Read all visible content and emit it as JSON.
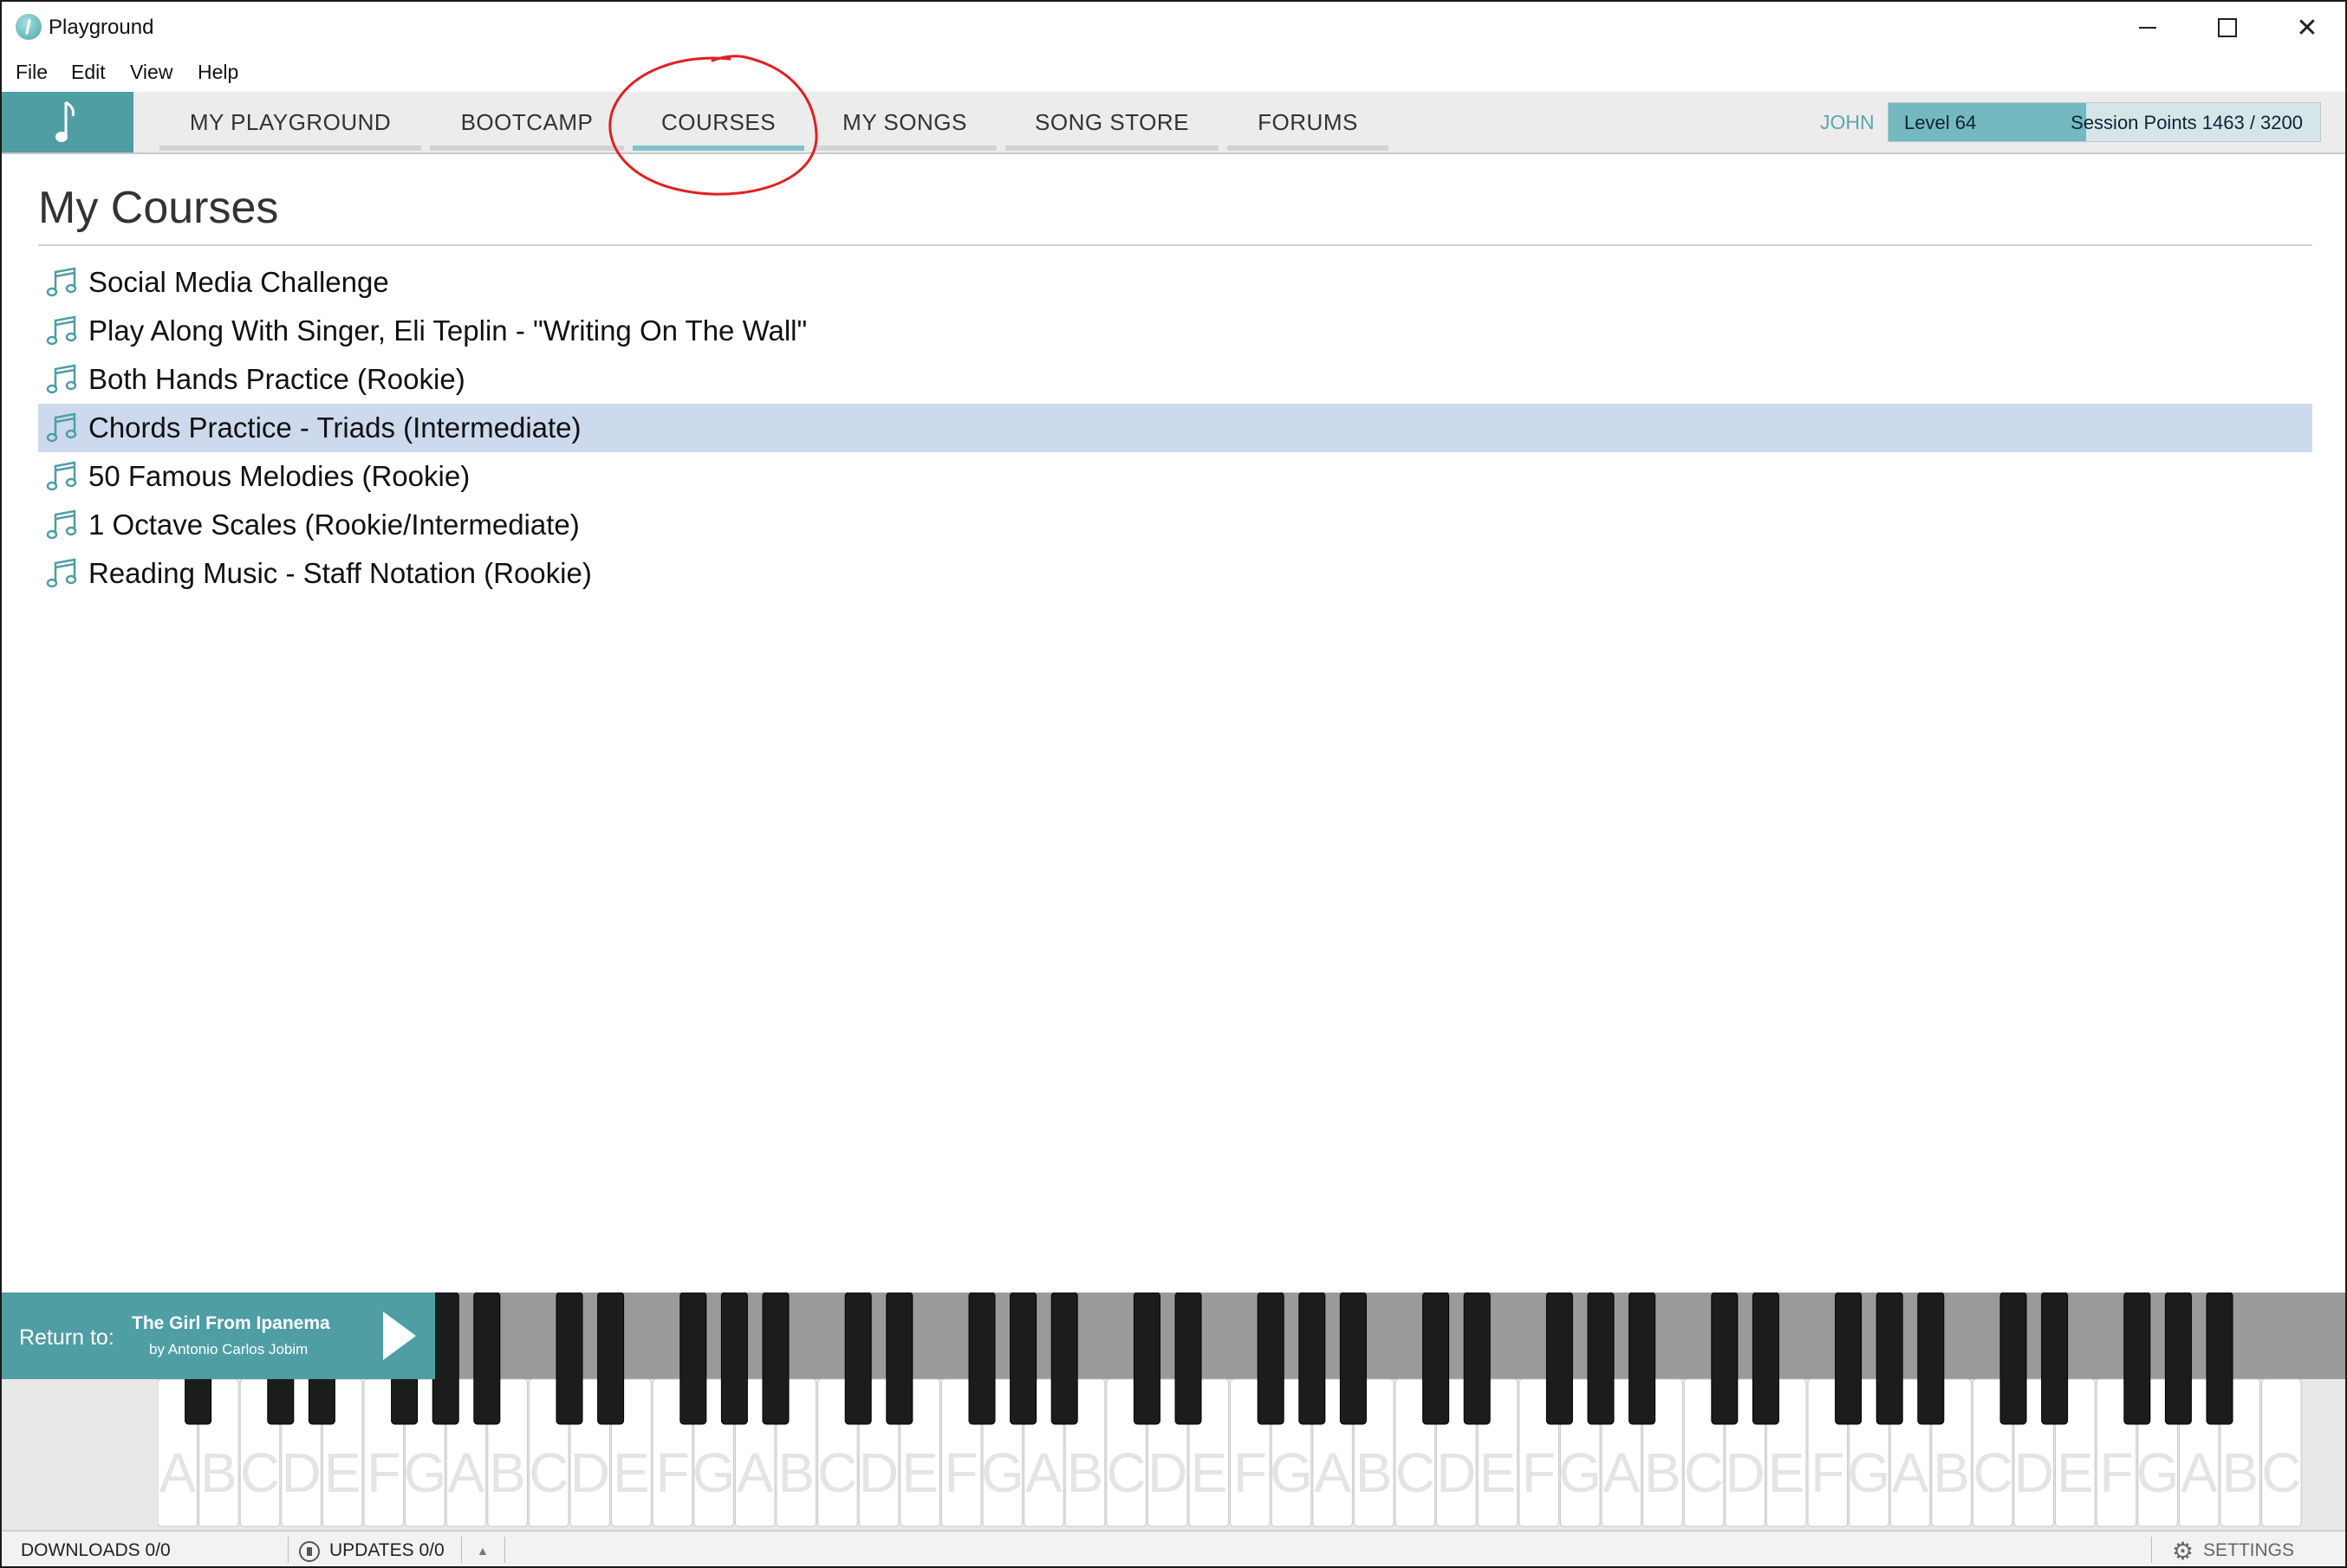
{
  "window": {
    "title": "Playground",
    "controls": {
      "minimize": "",
      "maximize": "",
      "close": "✕"
    }
  },
  "menu": [
    "File",
    "Edit",
    "View",
    "Help"
  ],
  "nav": {
    "tabs": [
      {
        "label": "MY PLAYGROUND",
        "active": false
      },
      {
        "label": "BOOTCAMP",
        "active": false
      },
      {
        "label": "COURSES",
        "active": true
      },
      {
        "label": "MY SONGS",
        "active": false
      },
      {
        "label": "SONG STORE",
        "active": false
      },
      {
        "label": "FORUMS",
        "active": false
      }
    ],
    "user": "JOHN",
    "level": "Level 64",
    "session_points_text": "Session Points 1463 / 3200",
    "session_points_current": 1463,
    "session_points_max": 3200
  },
  "page": {
    "heading": "My Courses",
    "courses": [
      {
        "label": "Social Media Challenge",
        "selected": false
      },
      {
        "label": "Play Along With Singer, Eli Teplin - \"Writing On The Wall\"",
        "selected": false
      },
      {
        "label": "Both Hands Practice (Rookie)",
        "selected": false
      },
      {
        "label": "Chords Practice - Triads (Intermediate)",
        "selected": true
      },
      {
        "label": "50 Famous Melodies (Rookie)",
        "selected": false
      },
      {
        "label": "1 Octave Scales (Rookie/Intermediate)",
        "selected": false
      },
      {
        "label": "Reading Music - Staff Notation (Rookie)",
        "selected": false
      }
    ]
  },
  "player": {
    "return_label": "Return to:",
    "song_title": "The Girl From Ipanema",
    "song_artist": "by Antonio Carlos Jobim"
  },
  "piano": {
    "white_key_letters": [
      "A",
      "B",
      "C",
      "D",
      "E",
      "F",
      "G",
      "A",
      "B",
      "C",
      "D",
      "E",
      "F",
      "G",
      "A",
      "B",
      "C",
      "D",
      "E",
      "F",
      "G",
      "A",
      "B",
      "C",
      "D",
      "E",
      "F",
      "G",
      "A",
      "B",
      "C",
      "D",
      "E",
      "F",
      "G",
      "A",
      "B",
      "C",
      "D",
      "E",
      "F",
      "G",
      "A",
      "B",
      "C",
      "D",
      "E",
      "F",
      "G",
      "A",
      "B",
      "C"
    ]
  },
  "status": {
    "downloads": "DOWNLOADS 0/0",
    "updates": "UPDATES 0/0",
    "settings": "SETTINGS"
  },
  "colors": {
    "accent": "#4e9ea4",
    "selected_row": "#cddaee",
    "annotation": "#e02020"
  }
}
